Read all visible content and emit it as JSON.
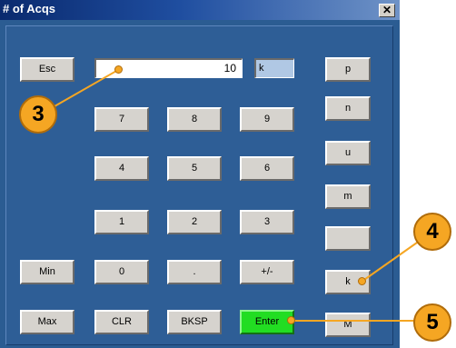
{
  "window": {
    "title": "# of Acqs",
    "close_label": "✕"
  },
  "entry": {
    "value": "10",
    "unit": "k"
  },
  "keys": {
    "esc": "Esc",
    "n7": "7",
    "n8": "8",
    "n9": "9",
    "n4": "4",
    "n5": "5",
    "n6": "6",
    "n1": "1",
    "n2": "2",
    "n3": "3",
    "min": "Min",
    "n0": "0",
    "dot": ".",
    "plusminus": "+/-",
    "max": "Max",
    "clr": "CLR",
    "bksp": "BKSP",
    "enter": "Enter"
  },
  "units": {
    "p": "p",
    "n": "n",
    "u": "u",
    "m": "m",
    "blank": "",
    "k": "k",
    "M": "M"
  },
  "callouts": {
    "c3": "3",
    "c4": "4",
    "c5": "5"
  },
  "colors": {
    "panel": "#2e5e96",
    "enter": "#22dd22",
    "callout": "#f5a623"
  }
}
